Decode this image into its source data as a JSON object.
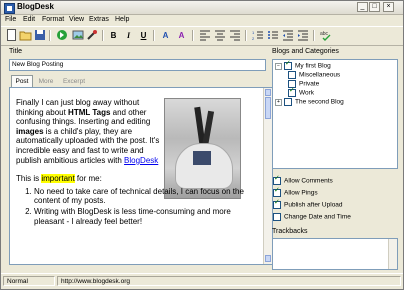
{
  "window": {
    "title": "BlogDesk"
  },
  "menu": [
    "File",
    "Edit",
    "Format",
    "View",
    "Extras",
    "Help"
  ],
  "left": {
    "title_label": "Title",
    "title_value": "New Blog Posting",
    "tabs": [
      "Post",
      "More",
      "Excerpt"
    ],
    "post": {
      "para1_a": "Finally I can just blog away without thinking about ",
      "para1_bold1": "HTML Tags",
      "para1_b": " and other confusing things. Inserting and editing ",
      "para1_bold2": "images",
      "para1_c": " is a child's play, they are automatically uploaded with the post. It's incredible easy and fast to write and publish ambitious articles with ",
      "para1_link": "BlogDesk",
      "para2_a": "This is ",
      "para2_hl": "important",
      "para2_b": " for me:",
      "list": [
        "No need to take care of technical details, I can focus on the content of my posts.",
        "Writing with BlogDesk is less time-consuming and more pleasant - I already feel better!"
      ]
    }
  },
  "right": {
    "tree_label": "Blogs and Categories",
    "tree": {
      "blog1": "My first Blog",
      "cats": [
        "Miscellaneous",
        "Private",
        "Work"
      ],
      "blog2": "The second Blog"
    },
    "options": [
      "Allow Comments",
      "Allow Pings",
      "Publish after Upload",
      "Change Date and Time"
    ],
    "trackbacks_label": "Trackbacks"
  },
  "status": {
    "mode": "Normal",
    "url": "http://www.blogdesk.org"
  }
}
